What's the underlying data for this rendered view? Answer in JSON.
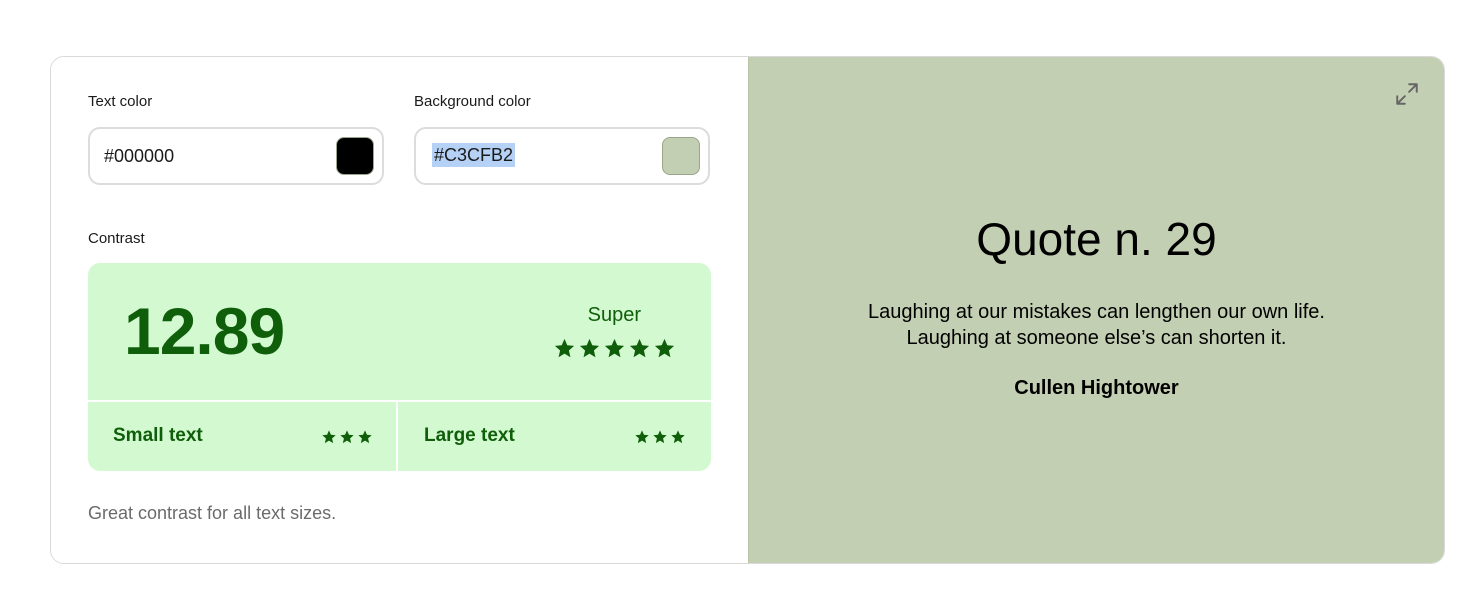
{
  "text_color": {
    "label": "Text color",
    "value": "#000000",
    "swatch": "#000000"
  },
  "background_color": {
    "label": "Background color",
    "value": "#C3CFB2",
    "swatch": "#C3CFB2"
  },
  "contrast": {
    "label": "Contrast",
    "ratio": "12.89",
    "rating": "Super",
    "rating_stars": 5,
    "small_text": {
      "label": "Small text",
      "stars": 3
    },
    "large_text": {
      "label": "Large text",
      "stars": 3
    },
    "verdict": "Great contrast for all text sizes."
  },
  "preview": {
    "icon": "expand-icon",
    "title": "Quote n. 29",
    "quote_line1": "Laughing at our mistakes can lengthen our own life.",
    "quote_line2": "Laughing at someone else’s can shorten it.",
    "author": "Cullen Hightower"
  },
  "colors": {
    "good_green": "#0f5e0a",
    "good_bg": "#d3f9d1",
    "selection": "#b5d1f5"
  }
}
